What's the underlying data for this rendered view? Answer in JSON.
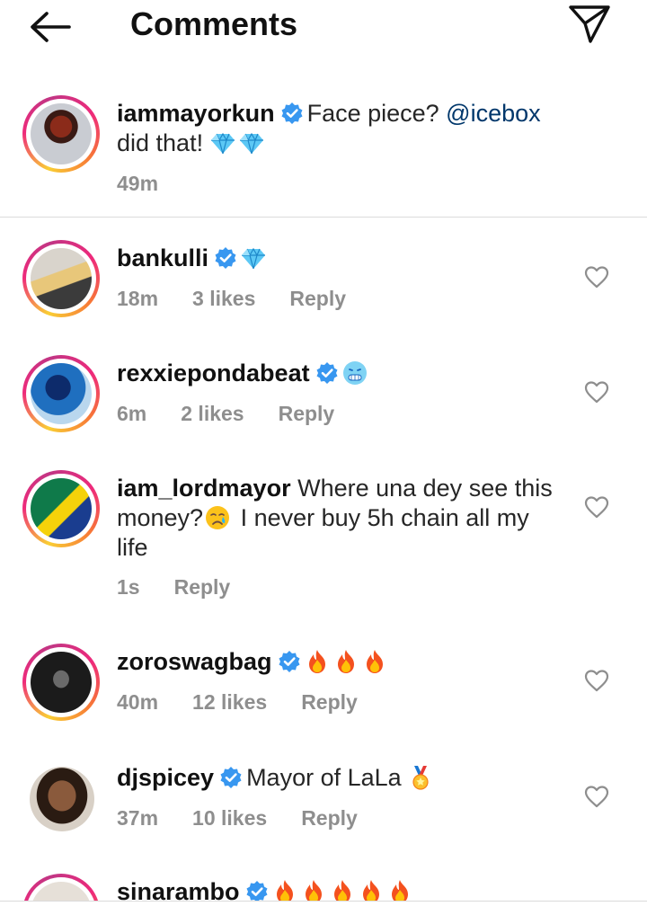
{
  "header": {
    "title": "Comments"
  },
  "caption": {
    "username": "iammayorkun",
    "text_before": "Face piece? ",
    "mention": "@icebox",
    "text_after": " did that! ",
    "time": "49m"
  },
  "comments": [
    {
      "username": "bankulli",
      "text": "",
      "time": "18m",
      "likes": "3 likes",
      "reply": "Reply",
      "emoji": [
        "gem-emoji"
      ]
    },
    {
      "username": "rexxiepondabeat",
      "text": "",
      "time": "6m",
      "likes": "2 likes",
      "reply": "Reply",
      "emoji": [
        "cold-face-emoji"
      ]
    },
    {
      "username": "iam_lordmayor",
      "text_before": " Where una dey see this money?",
      "text_after": " I never buy 5h chain all my life",
      "time": "1s",
      "reply": "Reply",
      "emoji": [
        "crying-face-emoji"
      ]
    },
    {
      "username": "zoroswagbag",
      "text": "",
      "time": "40m",
      "likes": "12 likes",
      "reply": "Reply",
      "emoji": [
        "fire-emoji",
        "fire-emoji",
        "fire-emoji"
      ]
    },
    {
      "username": "djspicey",
      "text": "Mayor  of LaLa ",
      "time": "37m",
      "likes": "10 likes",
      "reply": "Reply",
      "emoji": [
        "medal-emoji"
      ]
    },
    {
      "username": "sinarambo",
      "text": "",
      "emoji": [
        "fire-emoji",
        "fire-emoji",
        "fire-emoji",
        "fire-emoji",
        "fire-emoji"
      ]
    }
  ],
  "colors": {
    "accent": "#0095f6",
    "mention": "#00376b",
    "muted": "#8e8e8e",
    "verified": "#3897f0"
  }
}
